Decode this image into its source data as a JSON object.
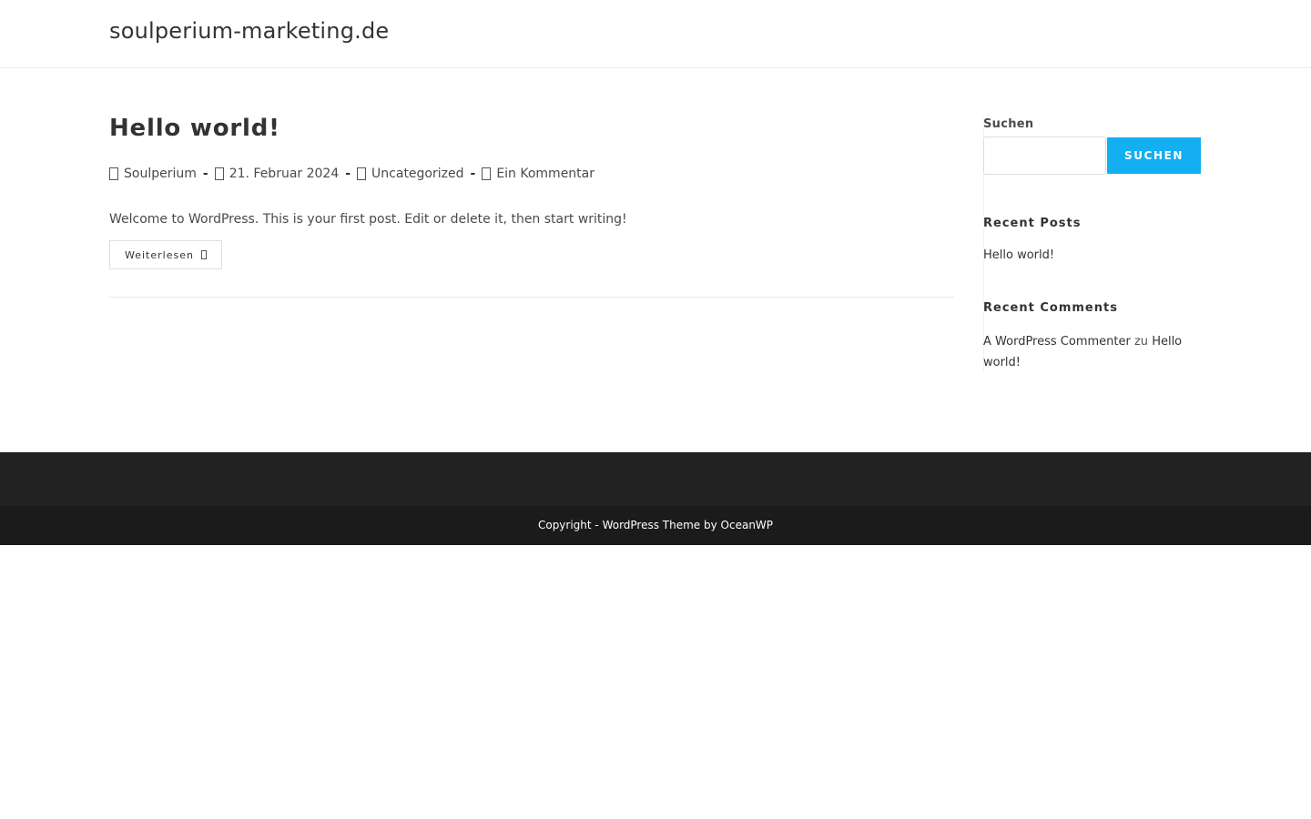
{
  "header": {
    "site_title": "soulperium-marketing.de"
  },
  "post": {
    "title": "Hello world!",
    "meta": {
      "author": "Soulperium",
      "date": "21. Februar 2024",
      "category": "Uncategorized",
      "comments": "Ein Kommentar",
      "separator": "-"
    },
    "excerpt": "Welcome to WordPress. This is your first post. Edit or delete it, then start writing!",
    "read_more_label": "Weiterlesen"
  },
  "sidebar": {
    "search": {
      "label": "Suchen",
      "input_value": "",
      "button_label": "SUCHEN"
    },
    "recent_posts": {
      "title": "Recent Posts",
      "items": [
        "Hello world!"
      ]
    },
    "recent_comments": {
      "title": "Recent Comments",
      "author": "A WordPress Commenter",
      "connector": "zu",
      "post": "Hello world!"
    }
  },
  "footer": {
    "copyright": "Copyright - WordPress Theme by OceanWP"
  },
  "colors": {
    "accent": "#13aff0",
    "footer_widgets": "#222222",
    "footer_bottom": "#1b1b1b"
  }
}
